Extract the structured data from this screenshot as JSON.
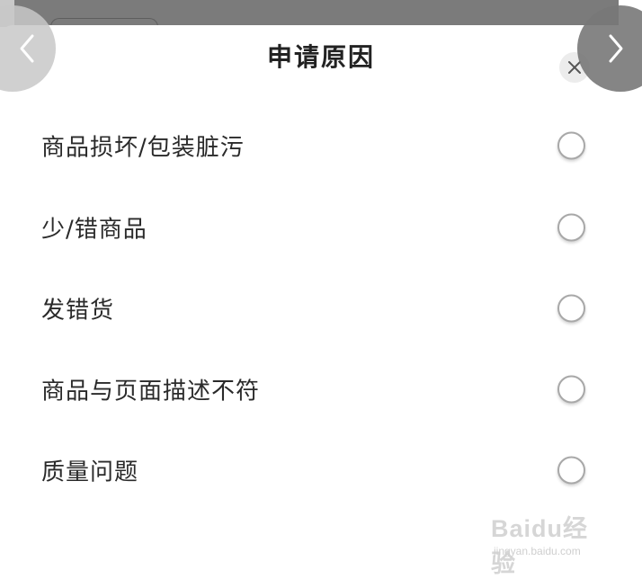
{
  "sheet": {
    "title": "申请原因",
    "close_icon": "close-icon"
  },
  "options": [
    {
      "label": "商品损坏/包装脏污",
      "selected": false
    },
    {
      "label": "少/错商品",
      "selected": false
    },
    {
      "label": "发错货",
      "selected": false
    },
    {
      "label": "商品与页面描述不符",
      "selected": false
    },
    {
      "label": "质量问题",
      "selected": false
    }
  ],
  "nav": {
    "prev_icon": "chevron-left-icon",
    "next_icon": "chevron-right-icon"
  },
  "watermark": {
    "brand": "Baidu经验",
    "url": "jingyan.baidu.com"
  },
  "colors": {
    "text": "#2a2a2a",
    "radio_border": "#a8a8a8",
    "overlay": "#7b7b7b"
  }
}
